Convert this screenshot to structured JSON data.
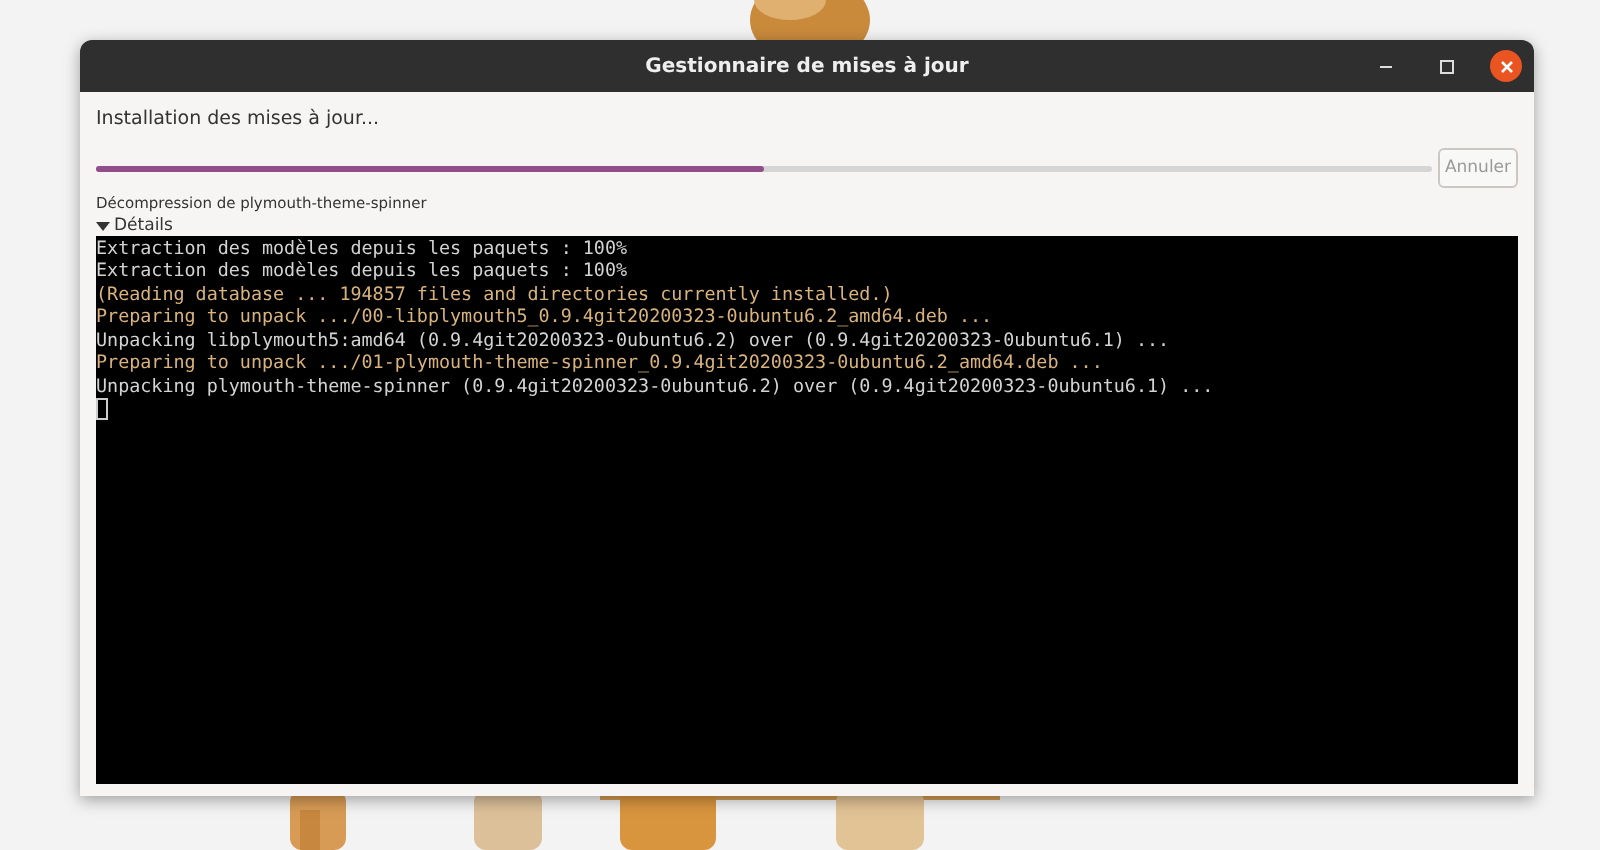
{
  "window": {
    "title": "Gestionnaire de mises à jour"
  },
  "heading": "Installation des mises à jour...",
  "progress": {
    "level": 0.5
  },
  "cancel_button": {
    "label": "Annuler",
    "disabled": true
  },
  "status": "Décompression de plymouth-theme-spinner",
  "details": {
    "label": "Détails",
    "expanded": true
  },
  "terminal": {
    "lines": [
      {
        "text": "Extraction des modèles depuis les paquets : 100%",
        "color": "#d3d3d3"
      },
      {
        "text": "Extraction des modèles depuis les paquets : 100%",
        "color": "#d3d3d3"
      },
      {
        "text": "(Reading database ... 194857 files and directories currently installed.)",
        "color": "#d9b27c"
      },
      {
        "text": "Preparing to unpack .../00-libplymouth5_0.9.4git20200323-0ubuntu6.2_amd64.deb ...",
        "color": "#d9b27c"
      },
      {
        "text": "Unpacking libplymouth5:amd64 (0.9.4git20200323-0ubuntu6.2) over (0.9.4git20200323-0ubuntu6.1) ...",
        "color": "#d3d3d3"
      },
      {
        "text": "Preparing to unpack .../01-plymouth-theme-spinner_0.9.4git20200323-0ubuntu6.2_amd64.deb ...",
        "color": "#d9b27c"
      },
      {
        "text": "Unpacking plymouth-theme-spinner (0.9.4git20200323-0ubuntu6.2) over (0.9.4git20200323-0ubuntu6.1) ...",
        "color": "#d3d3d3"
      }
    ]
  }
}
